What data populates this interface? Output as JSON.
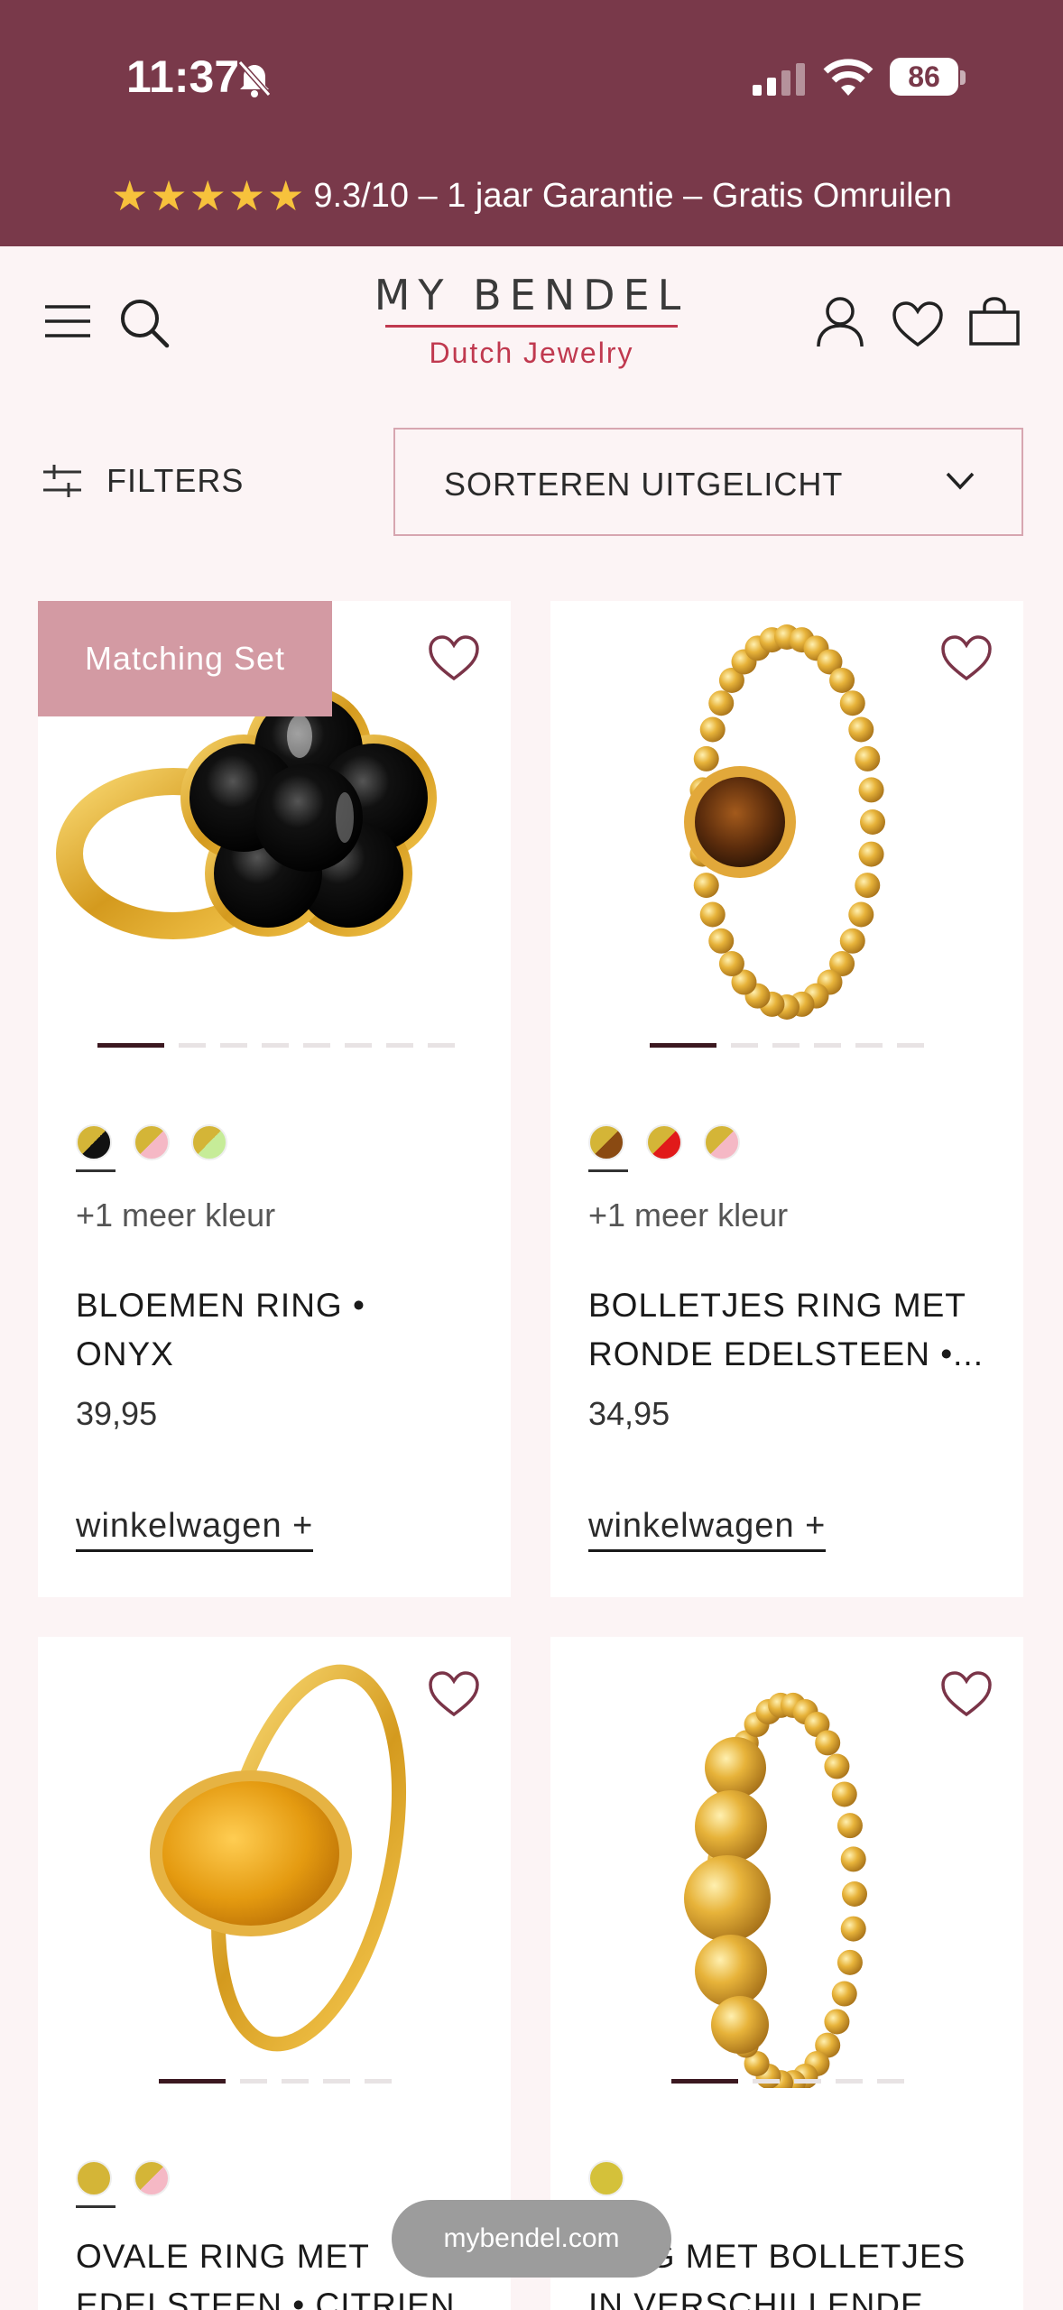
{
  "status": {
    "time": "11:37",
    "battery": "86"
  },
  "promo": {
    "stars": "★★★★★",
    "text": "9.3/10 – 1 jaar Garantie – Gratis Omruilen"
  },
  "logo": {
    "main": "MY BENDEL",
    "sub": "Dutch Jewelry"
  },
  "toolbar": {
    "filters_label": "FILTERS",
    "sort_label": "SORTEREN UITGELICHT"
  },
  "products": [
    {
      "badge": "Matching Set",
      "more_colors": "+1 meer kleur",
      "title": "BLOEMEN RING • ONYX",
      "price": "39,95",
      "cart_label": "winkelwagen +",
      "swatches": [
        [
          "#d4b537",
          "#111111"
        ],
        [
          "#d4b537",
          "#f5b8c5"
        ],
        [
          "#d4b537",
          "#c6ec98"
        ]
      ]
    },
    {
      "badge": "",
      "more_colors": "+1 meer kleur",
      "title": "BOLLETJES RING MET RONDE EDELSTEEN •...",
      "price": "34,95",
      "cart_label": "winkelwagen +",
      "swatches": [
        [
          "#d4b537",
          "#8a4a12"
        ],
        [
          "#d4b537",
          "#e11a1a"
        ],
        [
          "#d4b537",
          "#f5b8c5"
        ]
      ]
    },
    {
      "badge": "",
      "title": "OVALE RING MET EDELSTEEN • CITRIEN",
      "swatches": [
        [
          "#d4b537",
          "#d4b537"
        ],
        [
          "#d4b537",
          "#f5b8c5"
        ]
      ]
    },
    {
      "badge": "",
      "title": "RING MET BOLLETJES IN VERSCHILLENDE",
      "swatches": [
        [
          "#d4c13a",
          "#d4c13a"
        ]
      ]
    }
  ],
  "browser": {
    "url": "mybendel.com"
  }
}
